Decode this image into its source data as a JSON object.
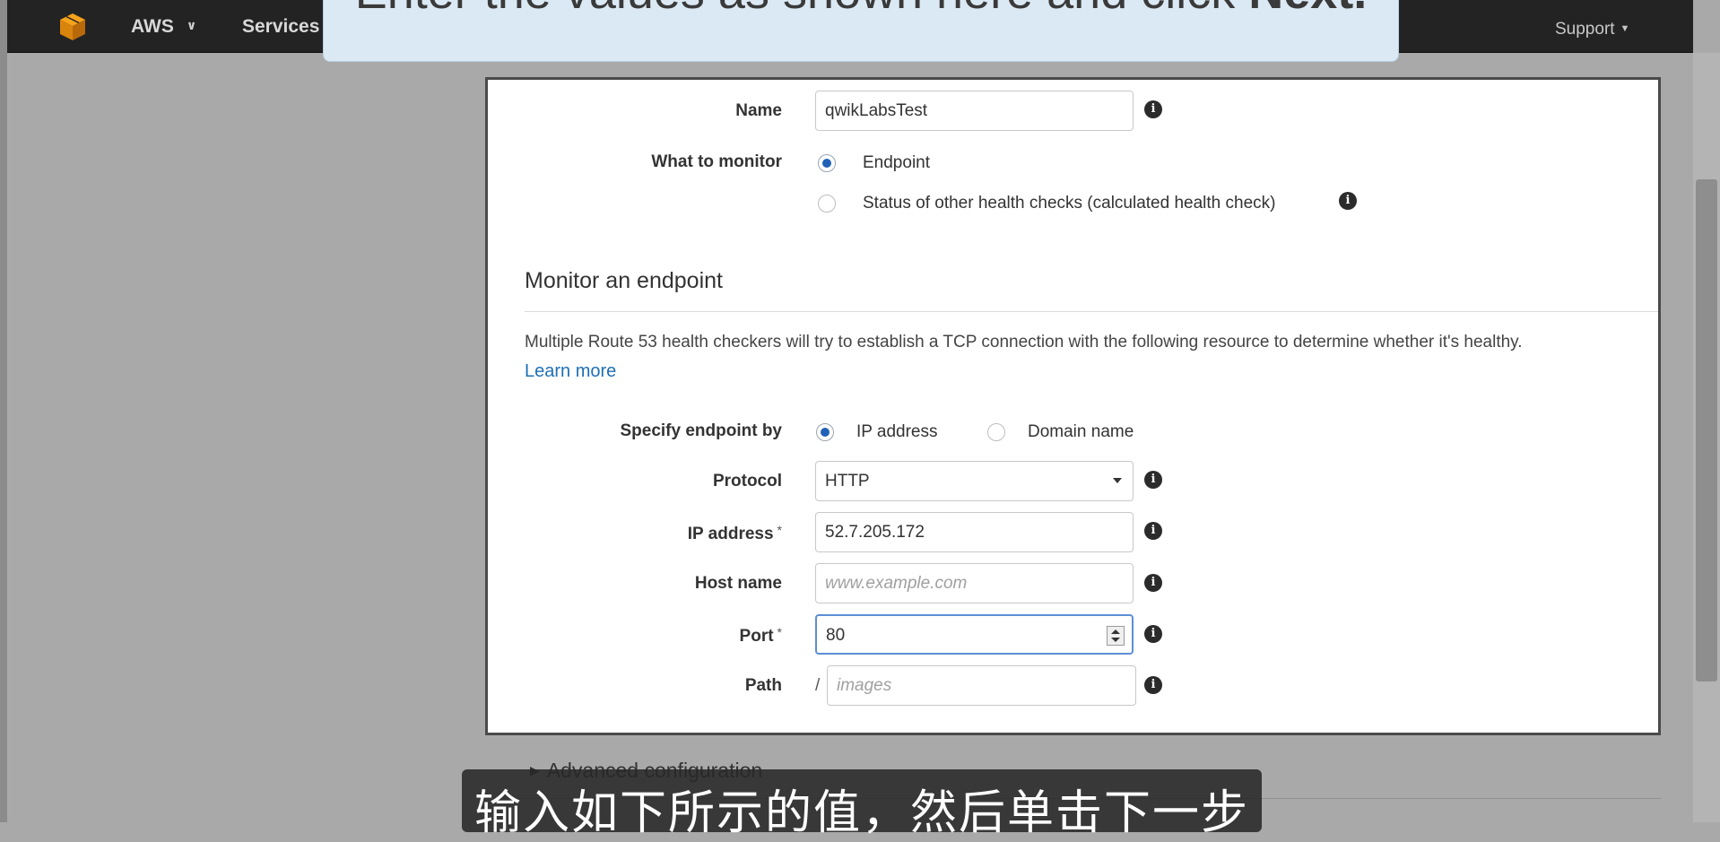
{
  "nav": {
    "aws_label": "AWS",
    "services_label": "Services",
    "support_label": "Support"
  },
  "banner": {
    "text_prefix": "Enter the values as shown here and click ",
    "text_bold": "Next."
  },
  "form": {
    "name": {
      "label": "Name",
      "value": "qwikLabsTest"
    },
    "what_to_monitor": {
      "label": "What to monitor",
      "options": [
        {
          "label": "Endpoint",
          "checked": true
        },
        {
          "label": "Status of other health checks (calculated health check)",
          "checked": false
        }
      ]
    },
    "section": {
      "title": "Monitor an endpoint",
      "description": "Multiple Route 53 health checkers will try to establish a TCP connection with the following resource to determine whether it's healthy.",
      "learn_more": "Learn more"
    },
    "specify_endpoint_by": {
      "label": "Specify endpoint by",
      "options": [
        {
          "label": "IP address",
          "checked": true
        },
        {
          "label": "Domain name",
          "checked": false
        }
      ]
    },
    "protocol": {
      "label": "Protocol",
      "value": "HTTP"
    },
    "ip_address": {
      "label": "IP address",
      "required_mark": "*",
      "value": "52.7.205.172"
    },
    "host_name": {
      "label": "Host name",
      "placeholder": "www.example.com"
    },
    "port": {
      "label": "Port",
      "required_mark": "*",
      "value": "80"
    },
    "path": {
      "label": "Path",
      "prefix": "/",
      "placeholder": "images"
    },
    "info_glyph": "i"
  },
  "advanced": {
    "label": "Advanced configuration"
  },
  "caption": {
    "text": "输入如下所示的值，然后单击下一步"
  }
}
